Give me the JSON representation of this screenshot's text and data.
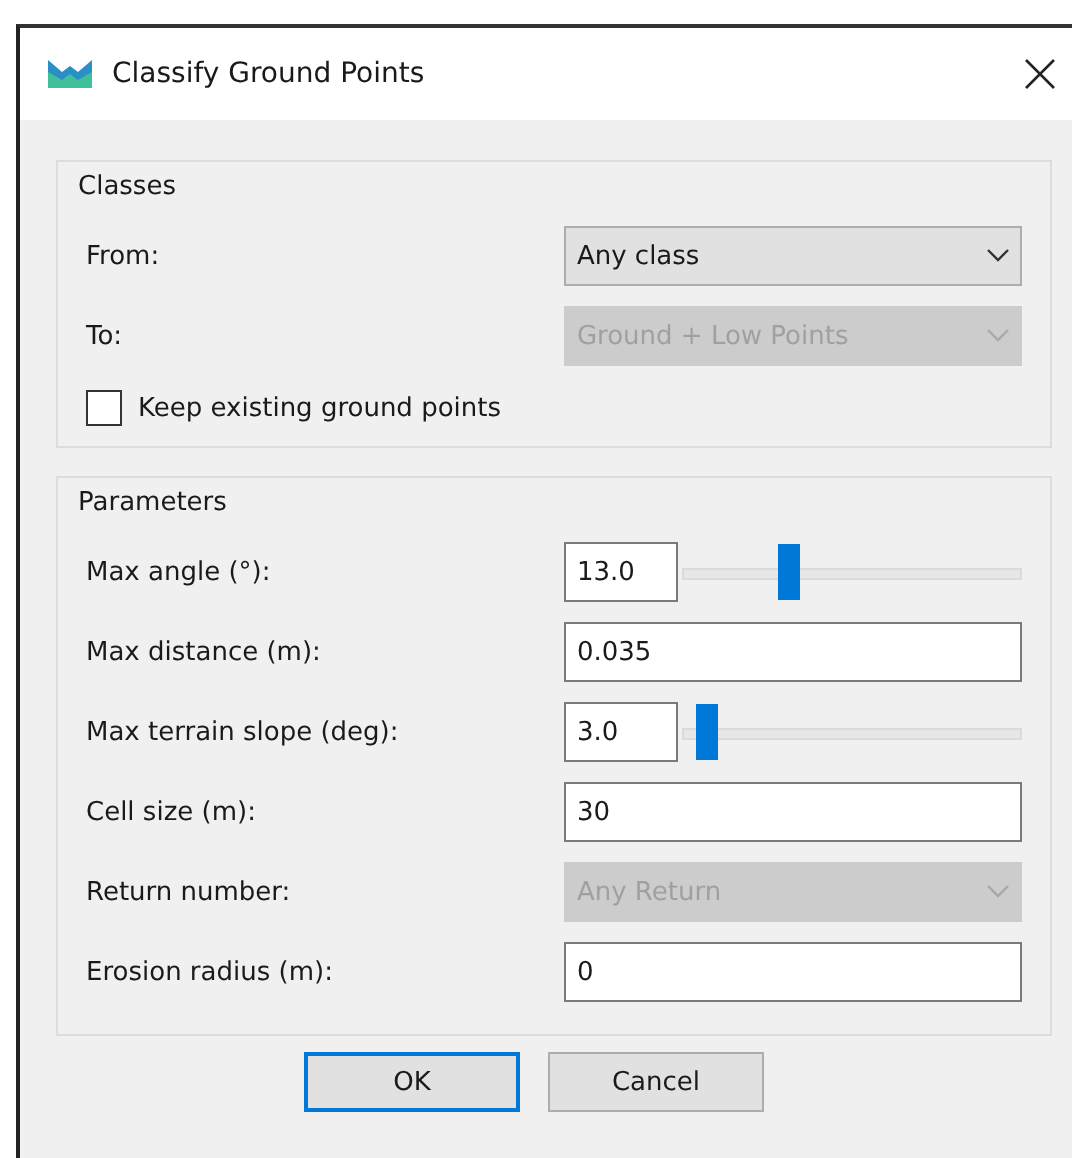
{
  "window": {
    "title": "Classify Ground Points"
  },
  "groups": [
    {
      "title": "Classes",
      "rows": [
        {
          "kind": "select",
          "label": "From:",
          "value": "Any class",
          "disabled": false
        },
        {
          "kind": "select",
          "label": "To:",
          "value": "Ground + Low Points",
          "disabled": true
        },
        {
          "kind": "checkbox",
          "label": "Keep existing ground points",
          "checked": false
        }
      ]
    },
    {
      "title": "Parameters",
      "rows": [
        {
          "kind": "slider",
          "label": "Max angle (°):",
          "value": "13.0",
          "level": 0.31
        },
        {
          "kind": "input",
          "label": "Max distance (m):",
          "value": "0.035"
        },
        {
          "kind": "slider",
          "label": "Max terrain slope (deg):",
          "value": "3.0",
          "level": 0.07
        },
        {
          "kind": "input",
          "label": "Cell size (m):",
          "value": "30"
        },
        {
          "kind": "select",
          "label": "Return number:",
          "value": "Any Return",
          "disabled": true
        },
        {
          "kind": "input",
          "label": "Erosion radius (m):",
          "value": "0"
        }
      ]
    }
  ],
  "buttons": [
    {
      "label": "OK",
      "default": true
    },
    {
      "label": "Cancel",
      "default": false
    }
  ]
}
